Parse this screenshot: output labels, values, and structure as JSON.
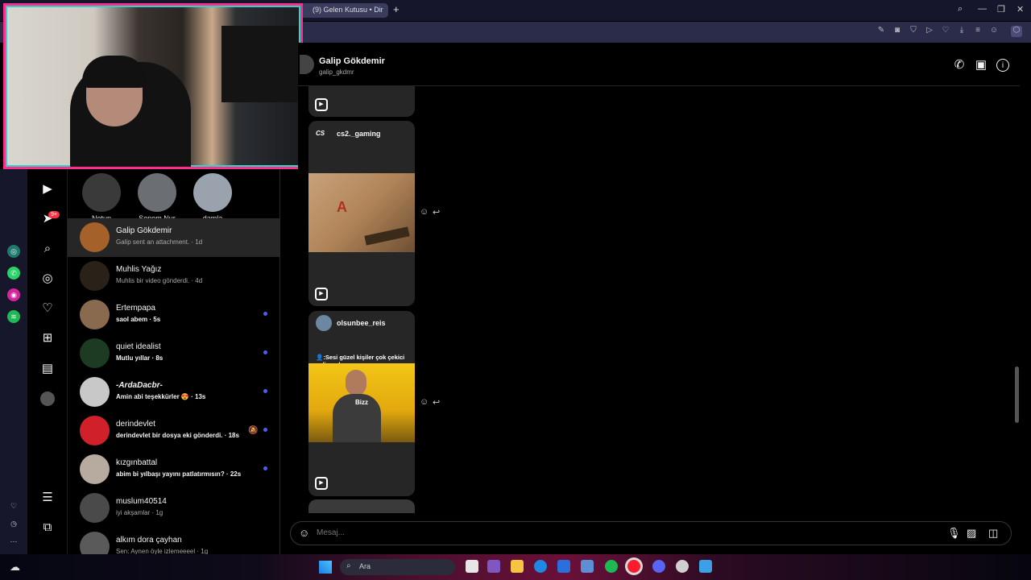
{
  "browser": {
    "tab_title": "(9) Gelen Kutusu • Dir",
    "new_tab": "+"
  },
  "nav": {
    "notification_badge": "9+"
  },
  "notes": [
    {
      "name": "Notun"
    },
    {
      "name": "Senem Nur"
    },
    {
      "name": "damla"
    }
  ],
  "conversations": [
    {
      "name": "Galip Gökdemir",
      "preview": "Galip sent an attachment. · 1d",
      "unread": false,
      "active": true
    },
    {
      "name": "Muhlis Yağız",
      "preview": "Muhlis bir video gönderdi. · 4d",
      "unread": false
    },
    {
      "name": "Ertempapa",
      "preview": "saol abem · 5s",
      "unread": true
    },
    {
      "name": "quiet idealist",
      "preview": "Mutlu yıllar · 8s",
      "unread": true
    },
    {
      "name": "-ArdaDacbr-",
      "preview": "Amin abi teşekkürler 😍 · 13s",
      "unread": true
    },
    {
      "name": "derindevlet",
      "preview": "derindevlet bir dosya eki gönderdi. · 18s",
      "unread": true
    },
    {
      "name": "kızgınbattal",
      "preview": "abim bi yılbaşı yayını patlatırmısın? · 22s",
      "unread": true
    },
    {
      "name": "muslum40514",
      "preview": "iyi akşamlar · 1g",
      "unread": false
    },
    {
      "name": "alkım dora çayhan",
      "preview": "Sen: Aynen öyle izlemeeeel · 1g",
      "unread": false
    }
  ],
  "chat": {
    "name": "Galip Gökdemir",
    "username": "galip_gkdmr",
    "cards": [
      {
        "user": "cs2._gaming",
        "media_label": "A"
      },
      {
        "user": "olsunbee_reis",
        "caption": "👤:Sesi güzel kişiler çok çekici geliyon bana",
        "media_label": "Bizz"
      }
    ],
    "input_placeholder": "Mesaj..."
  },
  "taskbar": {
    "search_placeholder": "Ara"
  },
  "colors": {
    "accent_unread": "#4a5df9",
    "badge": "#ff3040",
    "webcam_border": "#ff2e8a"
  }
}
